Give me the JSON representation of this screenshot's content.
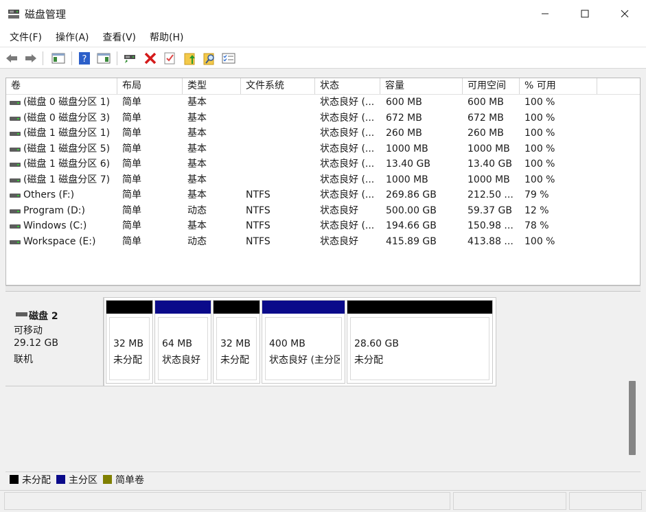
{
  "window": {
    "title": "磁盘管理",
    "minimize": "—",
    "maximize": "☐",
    "close": "✕"
  },
  "menu": [
    "文件(F)",
    "操作(A)",
    "查看(V)",
    "帮助(H)"
  ],
  "volume_columns": [
    "卷",
    "布局",
    "类型",
    "文件系统",
    "状态",
    "容量",
    "可用空间",
    "% 可用"
  ],
  "volumes": [
    {
      "name": "(磁盘 0 磁盘分区 1)",
      "layout": "简单",
      "type": "基本",
      "fs": "",
      "status": "状态良好 (...",
      "capacity": "600 MB",
      "free": "600 MB",
      "pct": "100 %"
    },
    {
      "name": "(磁盘 0 磁盘分区 3)",
      "layout": "简单",
      "type": "基本",
      "fs": "",
      "status": "状态良好 (...",
      "capacity": "672 MB",
      "free": "672 MB",
      "pct": "100 %"
    },
    {
      "name": "(磁盘 1 磁盘分区 1)",
      "layout": "简单",
      "type": "基本",
      "fs": "",
      "status": "状态良好 (...",
      "capacity": "260 MB",
      "free": "260 MB",
      "pct": "100 %"
    },
    {
      "name": "(磁盘 1 磁盘分区 5)",
      "layout": "简单",
      "type": "基本",
      "fs": "",
      "status": "状态良好 (...",
      "capacity": "1000 MB",
      "free": "1000 MB",
      "pct": "100 %"
    },
    {
      "name": "(磁盘 1 磁盘分区 6)",
      "layout": "简单",
      "type": "基本",
      "fs": "",
      "status": "状态良好 (...",
      "capacity": "13.40 GB",
      "free": "13.40 GB",
      "pct": "100 %"
    },
    {
      "name": "(磁盘 1 磁盘分区 7)",
      "layout": "简单",
      "type": "基本",
      "fs": "",
      "status": "状态良好 (...",
      "capacity": "1000 MB",
      "free": "1000 MB",
      "pct": "100 %"
    },
    {
      "name": "Others (F:)",
      "layout": "简单",
      "type": "基本",
      "fs": "NTFS",
      "status": "状态良好 (...",
      "capacity": "269.86 GB",
      "free": "212.50 ...",
      "pct": "79 %"
    },
    {
      "name": "Program (D:)",
      "layout": "简单",
      "type": "动态",
      "fs": "NTFS",
      "status": "状态良好",
      "capacity": "500.00 GB",
      "free": "59.37 GB",
      "pct": "12 %"
    },
    {
      "name": "Windows (C:)",
      "layout": "简单",
      "type": "基本",
      "fs": "NTFS",
      "status": "状态良好 (...",
      "capacity": "194.66 GB",
      "free": "150.98 ...",
      "pct": "78 %"
    },
    {
      "name": "Workspace (E:)",
      "layout": "简单",
      "type": "动态",
      "fs": "NTFS",
      "status": "状态良好",
      "capacity": "415.89 GB",
      "free": "413.88 ...",
      "pct": "100 %"
    }
  ],
  "disk": {
    "name": "磁盘 2",
    "kind": "可移动",
    "size": "29.12 GB",
    "state": "联机"
  },
  "partitions": [
    {
      "size": "32 MB",
      "status": "未分配",
      "color": "#000000"
    },
    {
      "size": "64 MB",
      "status": "状态良好",
      "color": "#0a0a8a"
    },
    {
      "size": "32 MB",
      "status": "未分配",
      "color": "#000000"
    },
    {
      "size": "400 MB",
      "status": "状态良好 (主分区)",
      "color": "#0a0a8a"
    },
    {
      "size": "28.60 GB",
      "status": "未分配",
      "color": "#000000"
    }
  ],
  "legend": [
    {
      "label": "未分配",
      "color": "#000000"
    },
    {
      "label": "主分区",
      "color": "#0a0a8a"
    },
    {
      "label": "简单卷",
      "color": "#808000"
    }
  ],
  "toolbar_icons": [
    "back-icon",
    "forward-icon",
    "console-tree-icon",
    "help-icon",
    "action-pane-icon",
    "connect-drive-icon",
    "delete-icon",
    "properties-icon",
    "export-icon",
    "search-icon",
    "list-icon"
  ]
}
